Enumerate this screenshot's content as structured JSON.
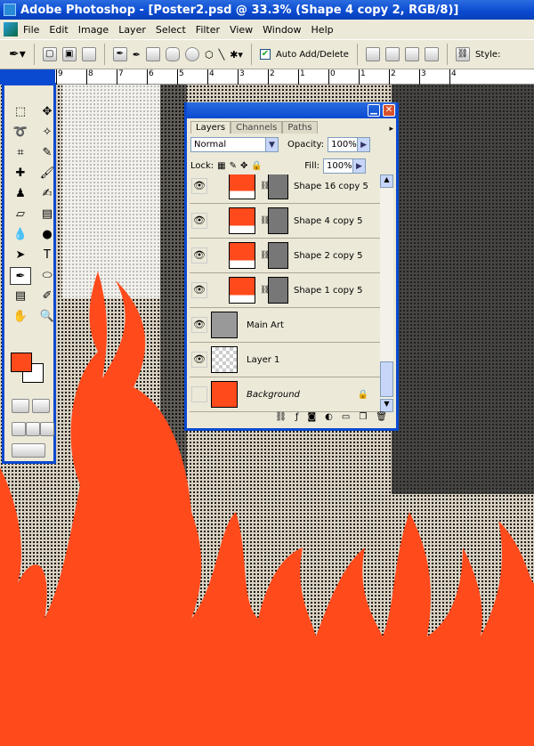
{
  "window": {
    "title": "Adobe Photoshop - [Poster2.psd @ 33.3% (Shape 4 copy 2, RGB/8)]"
  },
  "menu": [
    "File",
    "Edit",
    "Image",
    "Layer",
    "Select",
    "Filter",
    "View",
    "Window",
    "Help"
  ],
  "options": {
    "auto_add_delete": "Auto Add/Delete",
    "auto_add_checked": true,
    "style_label": "Style:"
  },
  "ruler": [
    "9",
    "8",
    "7",
    "6",
    "5",
    "4",
    "3",
    "2",
    "1",
    "0",
    "1",
    "2",
    "3",
    "4"
  ],
  "colors": {
    "foreground": "#ff4a1c",
    "background": "#ffffff",
    "flame": "#ff4a1c"
  },
  "layers_panel": {
    "tabs": [
      "Layers",
      "Channels",
      "Paths"
    ],
    "blend_mode": "Normal",
    "opacity_label": "Opacity:",
    "opacity": "100%",
    "lock_label": "Lock:",
    "fill_label": "Fill:",
    "fill": "100%",
    "layers": [
      {
        "name": "Shape 16 copy 5",
        "visible": true,
        "type": "shape"
      },
      {
        "name": "Shape 4 copy 5",
        "visible": true,
        "type": "shape"
      },
      {
        "name": "Shape 2 copy 5",
        "visible": true,
        "type": "shape"
      },
      {
        "name": "Shape 1 copy 5",
        "visible": true,
        "type": "shape"
      },
      {
        "name": "Main Art",
        "visible": true,
        "type": "image"
      },
      {
        "name": "Layer 1",
        "visible": true,
        "type": "image"
      },
      {
        "name": "Background",
        "visible": false,
        "type": "background",
        "locked": true
      }
    ]
  }
}
